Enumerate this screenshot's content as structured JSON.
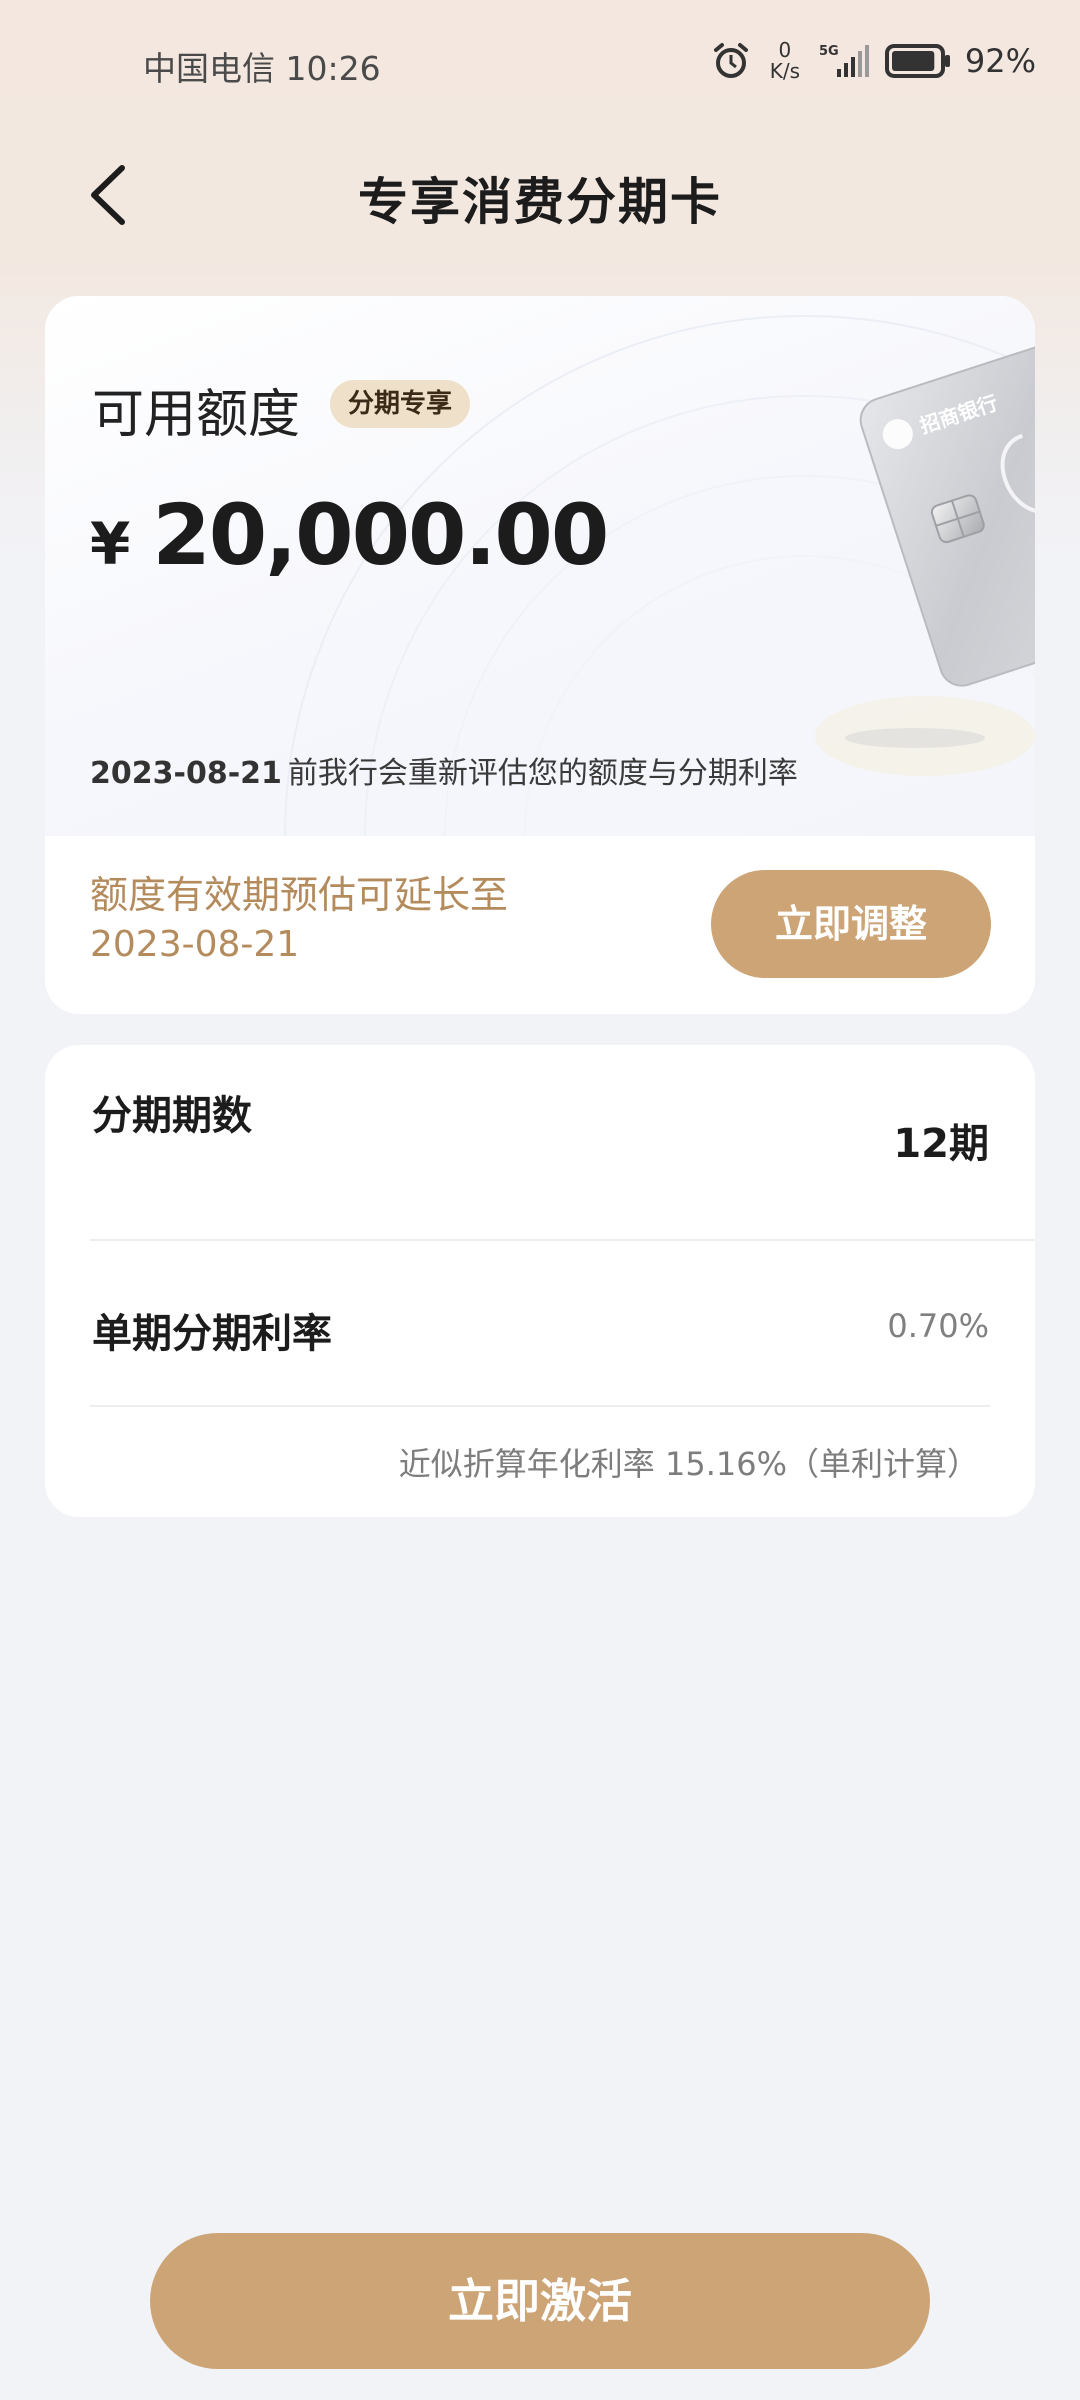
{
  "status_bar": {
    "carrier_time": "中国电信 10:26",
    "speed_value": "0",
    "speed_unit": "K/s",
    "network": "5G",
    "battery_percent": "92%",
    "battery_level": 0.92
  },
  "header": {
    "title": "专享消费分期卡"
  },
  "limit_card": {
    "label": "可用额度",
    "badge": "分期专享",
    "currency_symbol": "¥",
    "amount": "20,000.00",
    "eval_date": "2023-08-21",
    "eval_note": "前我行会重新评估您的额度与分期利率",
    "card_bank_text": "招商银行",
    "validity_text": "额度有效期预估可延长至",
    "validity_date": "2023-08-21",
    "adjust_button": "立即调整"
  },
  "installment": {
    "period_label": "分期期数",
    "period_value": "12期",
    "rate_label": "单期分期利率",
    "rate_value": "0.70%",
    "annual_note": "近似折算年化利率 15.16%（单利计算）"
  },
  "activate_button": "立即激活",
  "colors": {
    "accent": "#cda475",
    "accent_text": "#b48b5d",
    "badge_bg": "#efe0c9"
  }
}
